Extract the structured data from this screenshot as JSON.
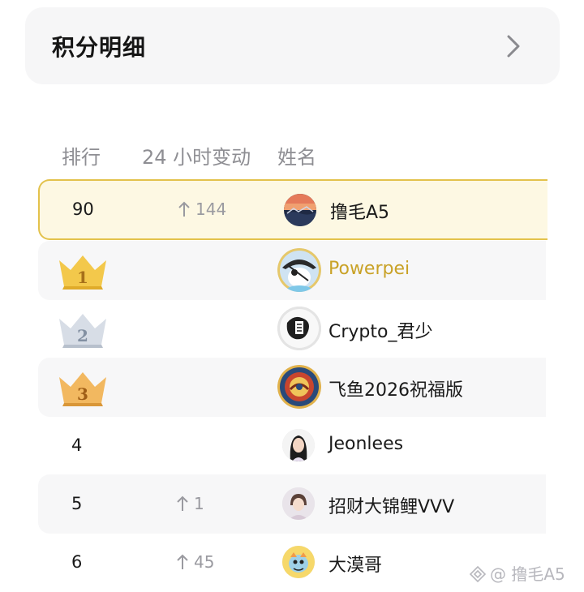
{
  "card": {
    "title": "积分明细",
    "icon": "chevron-right-icon"
  },
  "table": {
    "headers": {
      "rank": "排行",
      "change": "24 小时变动",
      "name": "姓名"
    },
    "my_row": {
      "rank": "90",
      "change": "144",
      "name": "撸毛A5",
      "highlight_color": "#e3c24c"
    },
    "rows": [
      {
        "rank_badge": "1",
        "rank_icon": "gold-crown-icon",
        "change": "",
        "name": "Powerpei",
        "name_color": "#c9a227"
      },
      {
        "rank_badge": "2",
        "rank_icon": "silver-crown-icon",
        "change": "",
        "name": "Crypto_君少"
      },
      {
        "rank_badge": "3",
        "rank_icon": "bronze-crown-icon",
        "change": "",
        "name": "飞鱼2026祝福版"
      },
      {
        "rank": "4",
        "change": "",
        "name": "Jeonlees"
      },
      {
        "rank": "5",
        "change": "1",
        "name": "招财大锦鲤VVV"
      },
      {
        "rank": "6",
        "change": "45",
        "name": "大漠哥"
      }
    ]
  },
  "watermark": {
    "text": "@ 撸毛A5",
    "icon": "binance-logo-icon"
  }
}
